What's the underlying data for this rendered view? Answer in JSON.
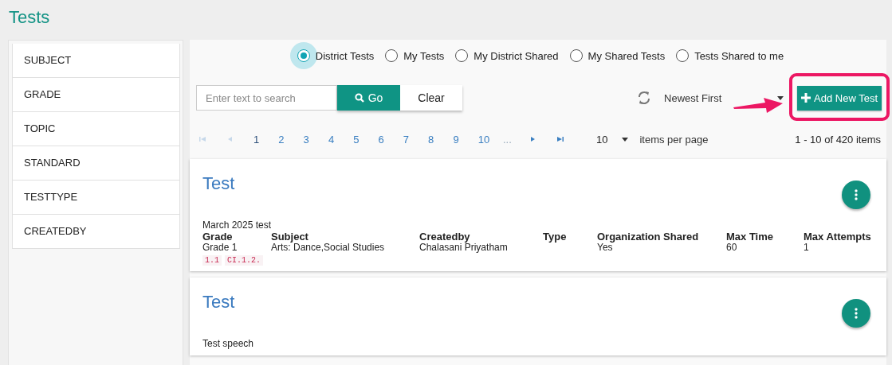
{
  "header": {
    "title": "Tests"
  },
  "sidebar": {
    "items": [
      {
        "label": "SUBJECT"
      },
      {
        "label": "GRADE"
      },
      {
        "label": "TOPIC"
      },
      {
        "label": "STANDARD"
      },
      {
        "label": "TESTTYPE"
      },
      {
        "label": "CREATEDBY"
      }
    ]
  },
  "filters": [
    {
      "label": "District Tests",
      "selected": true
    },
    {
      "label": "My Tests",
      "selected": false
    },
    {
      "label": "My District Shared",
      "selected": false
    },
    {
      "label": "My Shared Tests",
      "selected": false
    },
    {
      "label": "Tests Shared to me",
      "selected": false
    }
  ],
  "toolbar": {
    "search": {
      "placeholder": "Enter text to search"
    },
    "go_button": "Go",
    "clear_button": "Clear",
    "sort": "Newest First",
    "add_button": "Add New Test"
  },
  "pagination": {
    "pages": [
      {
        "label": "1",
        "selected": true
      },
      {
        "label": "2",
        "selected": false
      },
      {
        "label": "3",
        "selected": false
      },
      {
        "label": "4",
        "selected": false
      },
      {
        "label": "5",
        "selected": false
      },
      {
        "label": "6",
        "selected": false
      },
      {
        "label": "7",
        "selected": false
      },
      {
        "label": "8",
        "selected": false
      },
      {
        "label": "9",
        "selected": false
      },
      {
        "label": "10",
        "selected": false
      }
    ],
    "more": "...",
    "page_size": "10",
    "page_size_label": "items per page",
    "summary": "1 - 10 of 420 items"
  },
  "cards": [
    {
      "title": "Test",
      "description": "March 2025 test",
      "columns": [
        {
          "label": "Grade",
          "value": "Grade 1"
        },
        {
          "label": "Subject",
          "value": "Arts: Dance,Social Studies"
        },
        {
          "label": "Createdby",
          "value": "Chalasani Priyatham"
        },
        {
          "label": "Type"
        },
        {
          "label": "Organization Shared",
          "value": "Yes"
        },
        {
          "label": "Max Time",
          "value": "60"
        },
        {
          "label": "Max Attempts",
          "value": "1"
        }
      ],
      "tags": [
        "1.1",
        "CI.1.2."
      ]
    },
    {
      "title": "Test",
      "description": "Test speech"
    }
  ]
}
